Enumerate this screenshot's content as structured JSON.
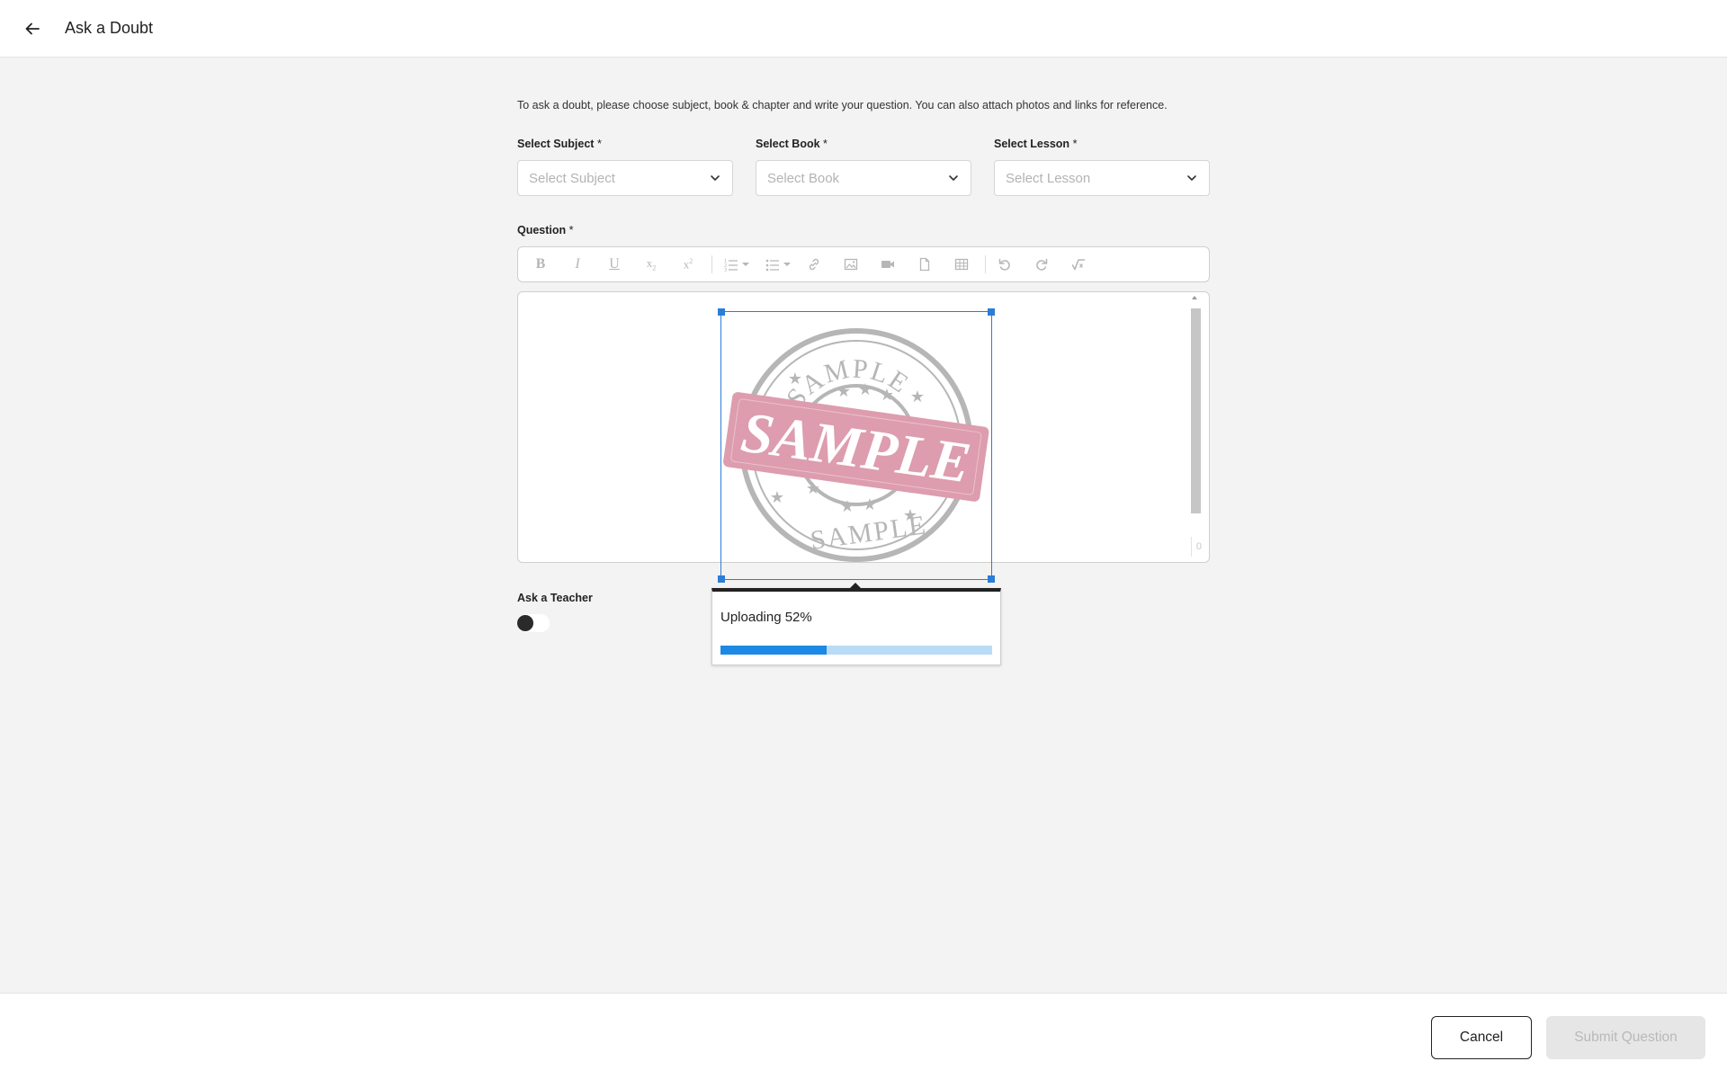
{
  "header": {
    "title": "Ask a Doubt",
    "back_icon": "arrow-left-icon"
  },
  "intro_text": "To ask a doubt, please choose subject, book & chapter and write your question. You can also attach photos and links for reference.",
  "selects": [
    {
      "label": "Select Subject",
      "required": "*",
      "placeholder": "Select Subject"
    },
    {
      "label": "Select Book",
      "required": "*",
      "placeholder": "Select Book"
    },
    {
      "label": "Select Lesson",
      "required": "*",
      "placeholder": "Select Lesson"
    }
  ],
  "question": {
    "label": "Question",
    "required": "*",
    "toolbar": [
      "bold-icon",
      "italic-icon",
      "underline-icon",
      "subscript-icon",
      "superscript-icon",
      "ordered-list-icon",
      "unordered-list-icon",
      "link-icon",
      "image-icon",
      "video-icon",
      "file-icon",
      "table-icon",
      "undo-icon",
      "redo-icon",
      "math-icon"
    ],
    "word_count": "0",
    "image": {
      "stamp_text": "SAMPLE"
    }
  },
  "upload": {
    "text": "Uploading 52%",
    "progress_percent": 52
  },
  "teacher": {
    "label": "Ask a Teacher",
    "enabled": false
  },
  "footer": {
    "cancel_label": "Cancel",
    "submit_label": "Submit Question"
  },
  "colors": {
    "accent": "#1e88e5",
    "progress_track": "#b9dbf5",
    "stamp_pink": "#c9627e",
    "stamp_gray": "#8a8a8a"
  }
}
